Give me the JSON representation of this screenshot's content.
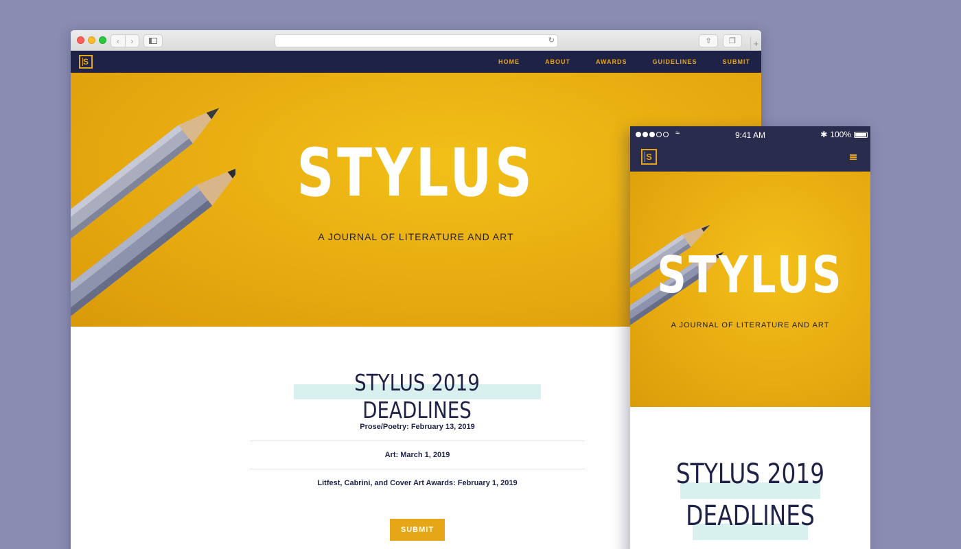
{
  "desktop": {
    "nav": {
      "logo": "S",
      "links": [
        "HOME",
        "ABOUT",
        "AWARDS",
        "GUIDELINES",
        "SUBMIT"
      ]
    },
    "hero": {
      "title": "STYLUS",
      "subtitle": "A JOURNAL OF LITERATURE AND ART"
    },
    "deadlines": {
      "title": "STYLUS 2019 DEADLINES",
      "items": [
        "Prose/Poetry: February 13, 2019",
        "Art: March 1, 2019",
        "Litfest, Cabrini, and Cover Art Awards: February 1, 2019"
      ],
      "submit_label": "SUBMIT"
    }
  },
  "mobile": {
    "status": {
      "time": "9:41 AM",
      "battery": "100%"
    },
    "logo": "S",
    "hero": {
      "title": "STYLUS",
      "subtitle": "A JOURNAL OF LITERATURE AND ART"
    },
    "deadlines": {
      "title_line1": "STYLUS 2019",
      "title_line2": "DEADLINES"
    }
  },
  "colors": {
    "background": "#8a8cb2",
    "navy": "#1f2247",
    "gold": "#e5a618",
    "highlight": "#d8f1ee"
  }
}
